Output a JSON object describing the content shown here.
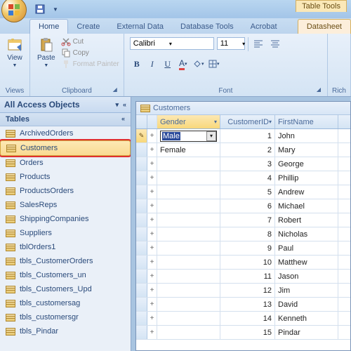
{
  "titlebar": {
    "table_tools": "Table Tools"
  },
  "ribbon": {
    "tabs": [
      "Home",
      "Create",
      "External Data",
      "Database Tools",
      "Acrobat",
      "Datasheet"
    ],
    "active_tab": "Home",
    "views": {
      "label": "View",
      "group": "Views"
    },
    "clipboard": {
      "paste": "Paste",
      "cut": "Cut",
      "copy": "Copy",
      "format_painter": "Format Painter",
      "group": "Clipboard"
    },
    "font": {
      "name": "Calibri",
      "size": "11",
      "group": "Font"
    },
    "richtext": {
      "group": "Rich"
    }
  },
  "nav": {
    "header": "All Access Objects",
    "group": "Tables",
    "items": [
      "ArchivedOrders",
      "Customers",
      "Orders",
      "Products",
      "ProductsOrders",
      "SalesReps",
      "ShippingCompanies",
      "Suppliers",
      "tblOrders1",
      "tbls_CustomerOrders",
      "tbls_Customers_un",
      "tbls_Customers_Upd",
      "tbls_customersag",
      "tbls_customersgr",
      "tbls_Pindar"
    ],
    "selected": "Customers"
  },
  "datasheet": {
    "title": "Customers",
    "columns": [
      "Gender",
      "CustomerID",
      "FirstName"
    ],
    "editing_value": "Male",
    "rows": [
      {
        "gender": "Male",
        "id": 1,
        "fname": "John"
      },
      {
        "gender": "Female",
        "id": 2,
        "fname": "Mary"
      },
      {
        "gender": "",
        "id": 3,
        "fname": "George"
      },
      {
        "gender": "",
        "id": 4,
        "fname": "Phillip"
      },
      {
        "gender": "",
        "id": 5,
        "fname": "Andrew"
      },
      {
        "gender": "",
        "id": 6,
        "fname": "Michael"
      },
      {
        "gender": "",
        "id": 7,
        "fname": "Robert"
      },
      {
        "gender": "",
        "id": 8,
        "fname": "Nicholas"
      },
      {
        "gender": "",
        "id": 9,
        "fname": "Paul"
      },
      {
        "gender": "",
        "id": 10,
        "fname": "Matthew"
      },
      {
        "gender": "",
        "id": 11,
        "fname": "Jason"
      },
      {
        "gender": "",
        "id": 12,
        "fname": "Jim"
      },
      {
        "gender": "",
        "id": 13,
        "fname": "David"
      },
      {
        "gender": "",
        "id": 14,
        "fname": "Kenneth"
      },
      {
        "gender": "",
        "id": 15,
        "fname": "Pindar"
      }
    ]
  }
}
